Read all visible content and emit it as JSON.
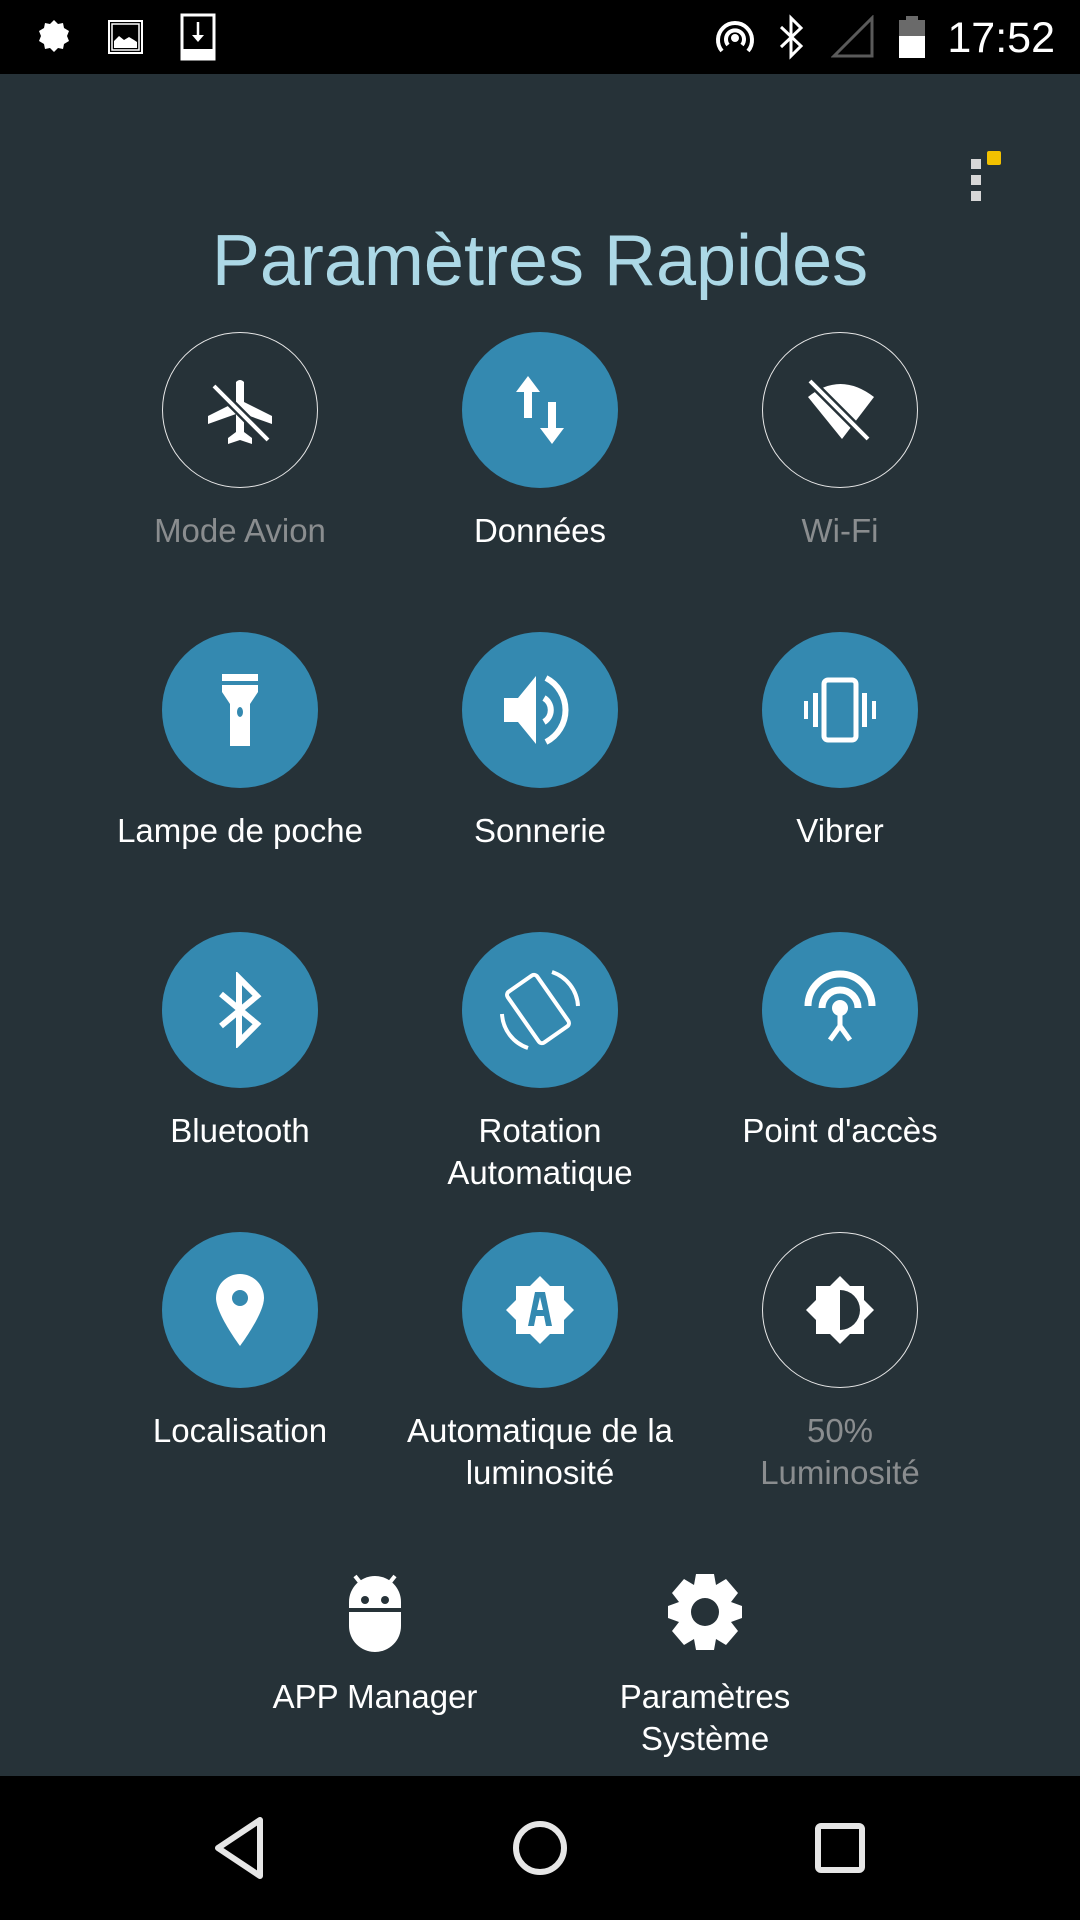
{
  "status_bar": {
    "left_icons": [
      "settings-notification-icon",
      "image-notification-icon",
      "download-notification-icon"
    ],
    "right_icons": [
      "hotspot-icon",
      "bluetooth-icon",
      "signal-empty-icon",
      "battery-half-icon"
    ],
    "time": "17:52"
  },
  "header": {
    "title": "Paramètres Rapides",
    "menu_icon": "more-vertical-icon",
    "menu_badge_color": "#f2c100"
  },
  "colors": {
    "background": "#263238",
    "active_circle": "#3489b0",
    "title": "#acd8e6",
    "inactive_label": "#8a8d8f"
  },
  "tiles": [
    {
      "id": "airplane",
      "label": "Mode Avion",
      "icon": "airplane-off-icon",
      "active": false
    },
    {
      "id": "data",
      "label": "Données",
      "icon": "data-transfer-icon",
      "active": true
    },
    {
      "id": "wifi",
      "label": "Wi-Fi",
      "icon": "wifi-off-icon",
      "active": false
    },
    {
      "id": "flashlight",
      "label": "Lampe de poche",
      "icon": "flashlight-icon",
      "active": true
    },
    {
      "id": "ringer",
      "label": "Sonnerie",
      "icon": "volume-icon",
      "active": true
    },
    {
      "id": "vibrate",
      "label": "Vibrer",
      "icon": "vibrate-icon",
      "active": true
    },
    {
      "id": "bluetooth",
      "label": "Bluetooth",
      "icon": "bluetooth-icon",
      "active": true
    },
    {
      "id": "rotation",
      "label": "Rotation Automatique",
      "label_lines": [
        "Rotation",
        "Automatique"
      ],
      "icon": "screen-rotation-icon",
      "active": true
    },
    {
      "id": "hotspot",
      "label": "Point d'accès",
      "icon": "hotspot-icon",
      "active": true
    },
    {
      "id": "location",
      "label": "Localisation",
      "icon": "location-pin-icon",
      "active": true
    },
    {
      "id": "auto_brightness",
      "label": "Automatique de la luminosité",
      "label_lines": [
        "Automatique de la",
        "luminosité"
      ],
      "icon": "brightness-auto-icon",
      "active": true
    },
    {
      "id": "brightness",
      "label": "50% Luminosité",
      "label_lines": [
        "50%",
        "Luminosité"
      ],
      "icon": "brightness-medium-icon",
      "active": false,
      "value_percent": 50
    }
  ],
  "shortcuts": [
    {
      "id": "app_manager",
      "label": "APP Manager",
      "label_lines": [
        "APP Manager"
      ],
      "icon": "android-icon"
    },
    {
      "id": "system_settings",
      "label": "Paramètres Système",
      "label_lines": [
        "Paramètres",
        "Système"
      ],
      "icon": "settings-gear-icon"
    }
  ],
  "nav_bar": {
    "back": "back-icon",
    "home": "home-icon",
    "recents": "recents-icon"
  }
}
